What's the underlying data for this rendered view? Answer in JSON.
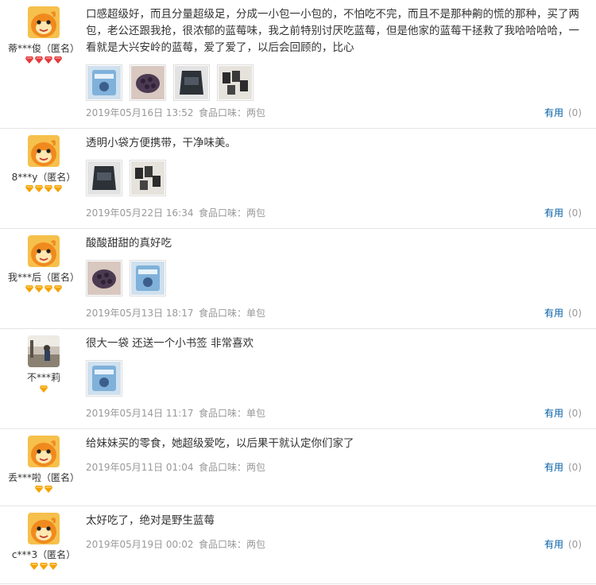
{
  "reviews": [
    {
      "username": "蒂***俊（匿名）",
      "badge_count": 4,
      "badge_color": "#e4393c",
      "text": "口感超级好，而且分量超级足，分成一小包一小包的，不怕吃不完，而且不是那种齁的慌的那种，买了两包，老公还跟我抢，很浓郁的蓝莓味，我之前特别讨厌吃蓝莓，但是他家的蓝莓干拯救了我哈哈哈哈，一看就是大兴安岭的蓝莓，爱了爱了，以后会回顾的，比心",
      "photos": [
        "blue-bag",
        "blueberries",
        "dark-bag",
        "dark-packs"
      ],
      "date": "2019年05月16日 13:52",
      "flavor": "食品口味：两包",
      "helpful_label": "有用",
      "helpful_count": "(0)"
    },
    {
      "username": "8***y（匿名）",
      "badge_count": 4,
      "badge_color": "#f5a300",
      "text": "透明小袋方便携带，干净味美。",
      "photos": [
        "dark-bag",
        "dark-packs"
      ],
      "date": "2019年05月22日 16:34",
      "flavor": "食品口味：两包",
      "helpful_label": "有用",
      "helpful_count": "(0)"
    },
    {
      "username": "我***后（匿名）",
      "badge_count": 4,
      "badge_color": "#f5a300",
      "text": "酸酸甜甜的真好吃",
      "photos": [
        "blueberries",
        "blue-bag"
      ],
      "date": "2019年05月13日 18:17",
      "flavor": "食品口味：单包",
      "helpful_label": "有用",
      "helpful_count": "(0)"
    },
    {
      "username": "不***莉",
      "badge_count": 1,
      "badge_color": "#f5a300",
      "text": "很大一袋 还送一个小书签 非常喜欢",
      "photos": [
        "blue-bag-wide"
      ],
      "date": "2019年05月14日 11:17",
      "flavor": "食品口味：单包",
      "helpful_label": "有用",
      "helpful_count": "(0)"
    },
    {
      "username": "丢***啦（匿名）",
      "badge_count": 2,
      "badge_color": "#f5a300",
      "text": "给妹妹买的零食，她超级爱吃，以后果干就认定你们家了",
      "photos": [],
      "date": "2019年05月11日 01:04",
      "flavor": "食品口味：两包",
      "helpful_label": "有用",
      "helpful_count": "(0)"
    },
    {
      "username": "c***3（匿名）",
      "badge_count": 3,
      "badge_color": "#f5a300",
      "text": "太好吃了，绝对是野生蓝莓",
      "photos": [],
      "date": "2019年05月19日 00:02",
      "flavor": "食品口味：两包",
      "helpful_label": "有用",
      "helpful_count": "(0)"
    }
  ]
}
